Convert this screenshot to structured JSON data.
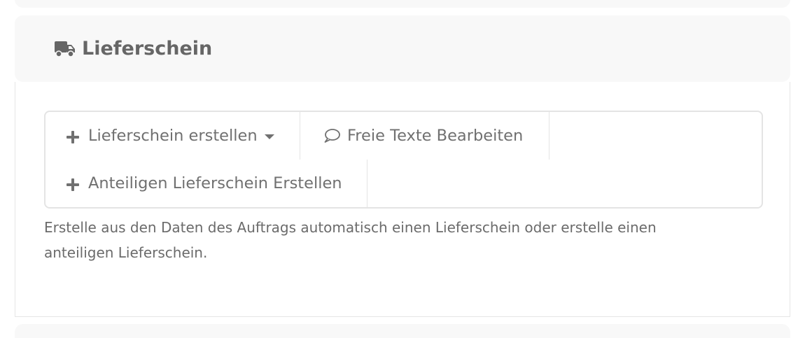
{
  "section": {
    "icon": "truck-icon",
    "title": "Lieferschein"
  },
  "buttons": {
    "create": {
      "icon": "plus-icon",
      "label": "Lieferschein erstellen",
      "dropdown_icon": "caret-down-icon"
    },
    "edit_texts": {
      "icon": "comment-icon",
      "label": "Freie Texte Bearbeiten"
    },
    "partial": {
      "icon": "plus-icon",
      "label": "Anteiligen Lieferschein Erstellen"
    }
  },
  "description": "Erstelle aus den Daten des Auftrags automatisch einen Lieferschein oder erstelle einen anteiligen Lieferschein."
}
